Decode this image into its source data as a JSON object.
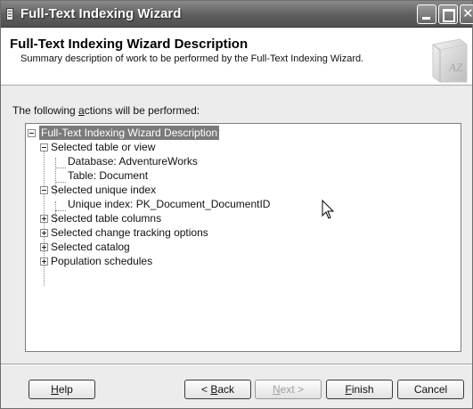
{
  "window": {
    "title": "Full-Text Indexing Wizard"
  },
  "header": {
    "title": "Full-Text Indexing Wizard Description",
    "subtitle": "Summary description of work to be performed by the Full-Text Indexing Wizard.",
    "icon": "book-az-icon"
  },
  "body": {
    "intro_before": "The following ",
    "intro_mnemonic": "a",
    "intro_after": "ctions will be performed:"
  },
  "tree": [
    {
      "label": "Full-Text Indexing Wizard Description",
      "level": 0,
      "expander": "minus",
      "selected": true
    },
    {
      "label": "Selected table or view",
      "level": 1,
      "expander": "minus"
    },
    {
      "label": "Database: AdventureWorks",
      "level": 2,
      "expander": "none"
    },
    {
      "label": "Table: Document",
      "level": 2,
      "expander": "none"
    },
    {
      "label": "Selected unique index",
      "level": 1,
      "expander": "minus"
    },
    {
      "label": "Unique index: PK_Document_DocumentID",
      "level": 2,
      "expander": "none"
    },
    {
      "label": "Selected table columns",
      "level": 1,
      "expander": "plus"
    },
    {
      "label": "Selected change tracking options",
      "level": 1,
      "expander": "plus"
    },
    {
      "label": "Selected catalog",
      "level": 1,
      "expander": "plus"
    },
    {
      "label": "Population schedules",
      "level": 1,
      "expander": "plus"
    }
  ],
  "buttons": {
    "help": {
      "mnemonic": "H",
      "rest": "elp"
    },
    "back": {
      "prefix": "< ",
      "mnemonic": "B",
      "rest": "ack"
    },
    "next": {
      "mnemonic": "N",
      "rest": "ext >",
      "disabled": true
    },
    "finish": {
      "mnemonic": "F",
      "rest": "inish"
    },
    "cancel": {
      "label": "Cancel"
    }
  },
  "colors": {
    "selection": "#7a7a7a",
    "titlebar": "#5e5e5e"
  }
}
